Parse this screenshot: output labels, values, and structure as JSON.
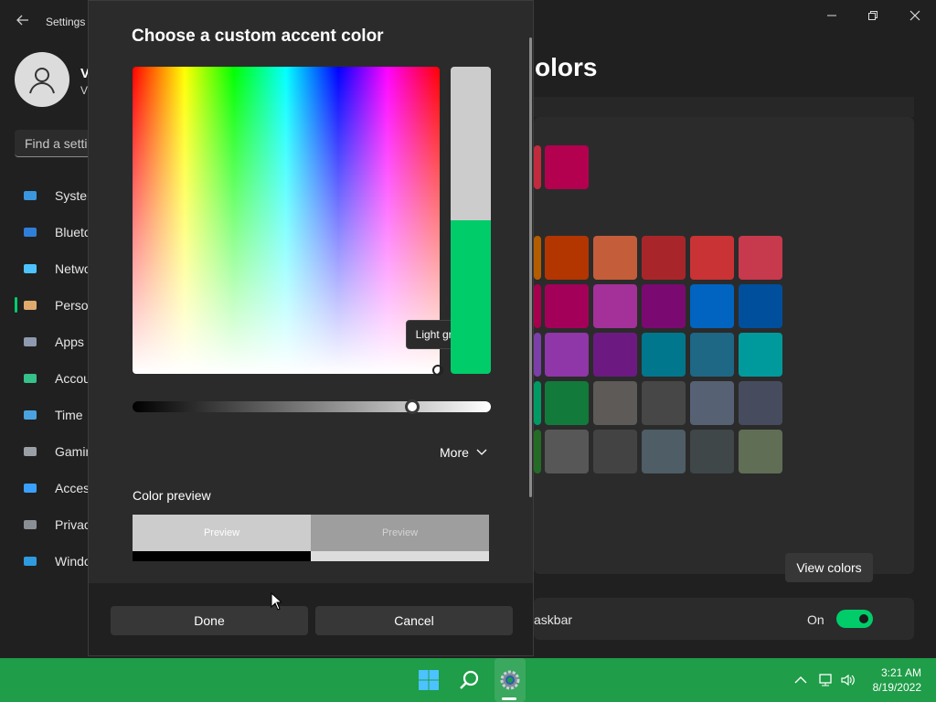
{
  "settings": {
    "title": "Settings",
    "user": {
      "name": "V",
      "sub": "V"
    },
    "search_placeholder": "Find a setti",
    "nav": [
      {
        "label": "Syster",
        "icon": "system-icon"
      },
      {
        "label": "Blueto",
        "icon": "bluetooth-icon"
      },
      {
        "label": "Netwo",
        "icon": "network-icon"
      },
      {
        "label": "Perso",
        "icon": "personalization-icon"
      },
      {
        "label": "Apps",
        "icon": "apps-icon"
      },
      {
        "label": "Accou",
        "icon": "accounts-icon"
      },
      {
        "label": "Time",
        "icon": "time-icon"
      },
      {
        "label": "Gamin",
        "icon": "gaming-icon"
      },
      {
        "label": "Acces",
        "icon": "accessibility-icon"
      },
      {
        "label": "Privac",
        "icon": "privacy-icon"
      },
      {
        "label": "Windo",
        "icon": "windows-update-icon"
      }
    ],
    "page_title": "olors",
    "view_colors_label": "View colors",
    "taskbar_row_label": "askbar",
    "toggle_state_label": "On",
    "recent_swatches": [
      "#c22a3e",
      "#b3004f"
    ],
    "swatch_grid": [
      [
        "#b35c00",
        "#b33500",
        "#c45d3a",
        "#a8262a",
        "#c93335",
        "#c7394d"
      ],
      [
        "#a6004e",
        "#a30059",
        "#a33199",
        "#7a0a72",
        "#0064c0",
        "#004f9c"
      ],
      [
        "#7b3fa8",
        "#8f36a8",
        "#6c1a82",
        "#00778c",
        "#1e6785",
        "#00999c"
      ],
      [
        "#009a65",
        "#127a3b",
        "#5d5a58",
        "#474747",
        "#566274",
        "#464c5e"
      ],
      [
        "#246b25",
        "#575757",
        "#434343",
        "#4e5d66",
        "#3f4749",
        "#5f6e55"
      ]
    ]
  },
  "dialog": {
    "title": "Choose a custom accent color",
    "tooltip": "Light gray",
    "more_label": "More",
    "preview_label": "Color preview",
    "preview_light_text": "Preview",
    "preview_dark_text": "Preview",
    "done_label": "Done",
    "cancel_label": "Cancel",
    "selected_color": "#cccccc",
    "previous_color": "#00cc6a",
    "value_level": 0.78
  },
  "taskbar": {
    "time": "3:21 AM",
    "date": "8/19/2022",
    "pinned": [
      "windows-start-icon",
      "search-icon",
      "settings-gear-icon"
    ],
    "tray": [
      "chevron-up-icon",
      "network-icon",
      "volume-icon"
    ]
  }
}
